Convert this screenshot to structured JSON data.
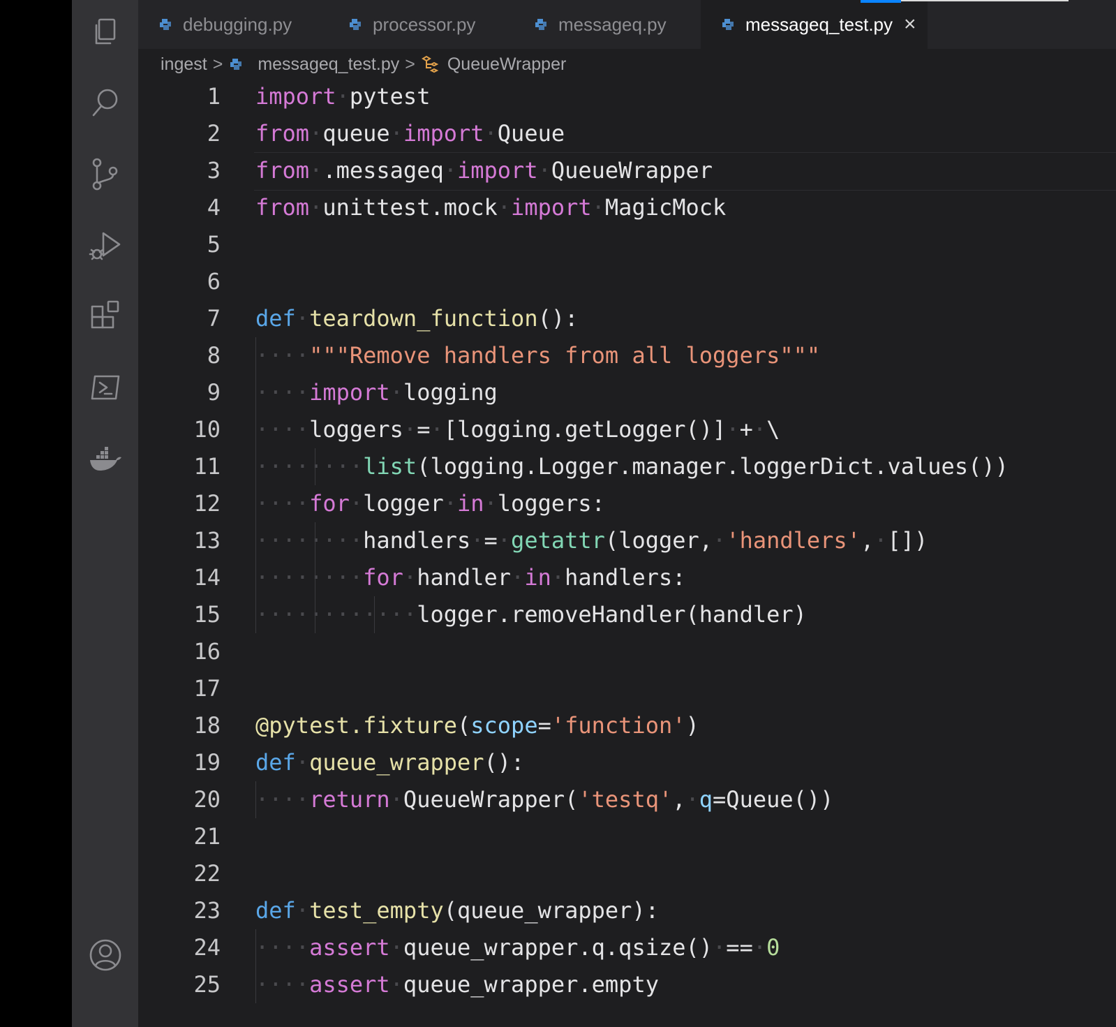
{
  "tabs": [
    {
      "label": "debugging.py",
      "active": false
    },
    {
      "label": "processor.py",
      "active": false
    },
    {
      "label": "messageq.py",
      "active": false
    },
    {
      "label": "messageq_test.py",
      "active": true
    }
  ],
  "close_glyph": "×",
  "breadcrumb": {
    "folder": "ingest",
    "file": "messageq_test.py",
    "symbol": "QueueWrapper",
    "separator": ">"
  },
  "activity_icons": [
    "explorer-icon",
    "search-icon",
    "source-control-icon",
    "run-debug-icon",
    "extensions-icon",
    "terminal-icon",
    "docker-icon",
    "account-icon"
  ],
  "colors": {
    "keyword": "#d57ad6",
    "def_keyword": "#5aa7e8",
    "function_name": "#e6e1a8",
    "builtin": "#82d7b5",
    "string": "#e99479",
    "number": "#b6dd9b",
    "parameter": "#8fd3ff",
    "accent": "#0a84ff"
  },
  "code_lines": [
    {
      "n": "1",
      "text": "import pytest"
    },
    {
      "n": "2",
      "text": "from queue import Queue"
    },
    {
      "n": "3",
      "text": "from .messageq import QueueWrapper"
    },
    {
      "n": "4",
      "text": "from unittest.mock import MagicMock"
    },
    {
      "n": "5",
      "text": ""
    },
    {
      "n": "6",
      "text": ""
    },
    {
      "n": "7",
      "text": "def teardown_function():"
    },
    {
      "n": "8",
      "text": "    \"\"\"Remove handlers from all loggers\"\"\""
    },
    {
      "n": "9",
      "text": "    import logging"
    },
    {
      "n": "10",
      "text": "    loggers = [logging.getLogger()] + \\"
    },
    {
      "n": "11",
      "text": "        list(logging.Logger.manager.loggerDict.values())"
    },
    {
      "n": "12",
      "text": "    for logger in loggers:"
    },
    {
      "n": "13",
      "text": "        handlers = getattr(logger, 'handlers', [])"
    },
    {
      "n": "14",
      "text": "        for handler in handlers:"
    },
    {
      "n": "15",
      "text": "            logger.removeHandler(handler)"
    },
    {
      "n": "16",
      "text": ""
    },
    {
      "n": "17",
      "text": ""
    },
    {
      "n": "18",
      "text": "@pytest.fixture(scope='function')"
    },
    {
      "n": "19",
      "text": "def queue_wrapper():"
    },
    {
      "n": "20",
      "text": "    return QueueWrapper('testq', q=Queue())"
    },
    {
      "n": "21",
      "text": ""
    },
    {
      "n": "22",
      "text": ""
    },
    {
      "n": "23",
      "text": "def test_empty(queue_wrapper):"
    },
    {
      "n": "24",
      "text": "    assert queue_wrapper.q.qsize() == 0"
    },
    {
      "n": "25",
      "text": "    assert queue_wrapper.empty"
    }
  ]
}
